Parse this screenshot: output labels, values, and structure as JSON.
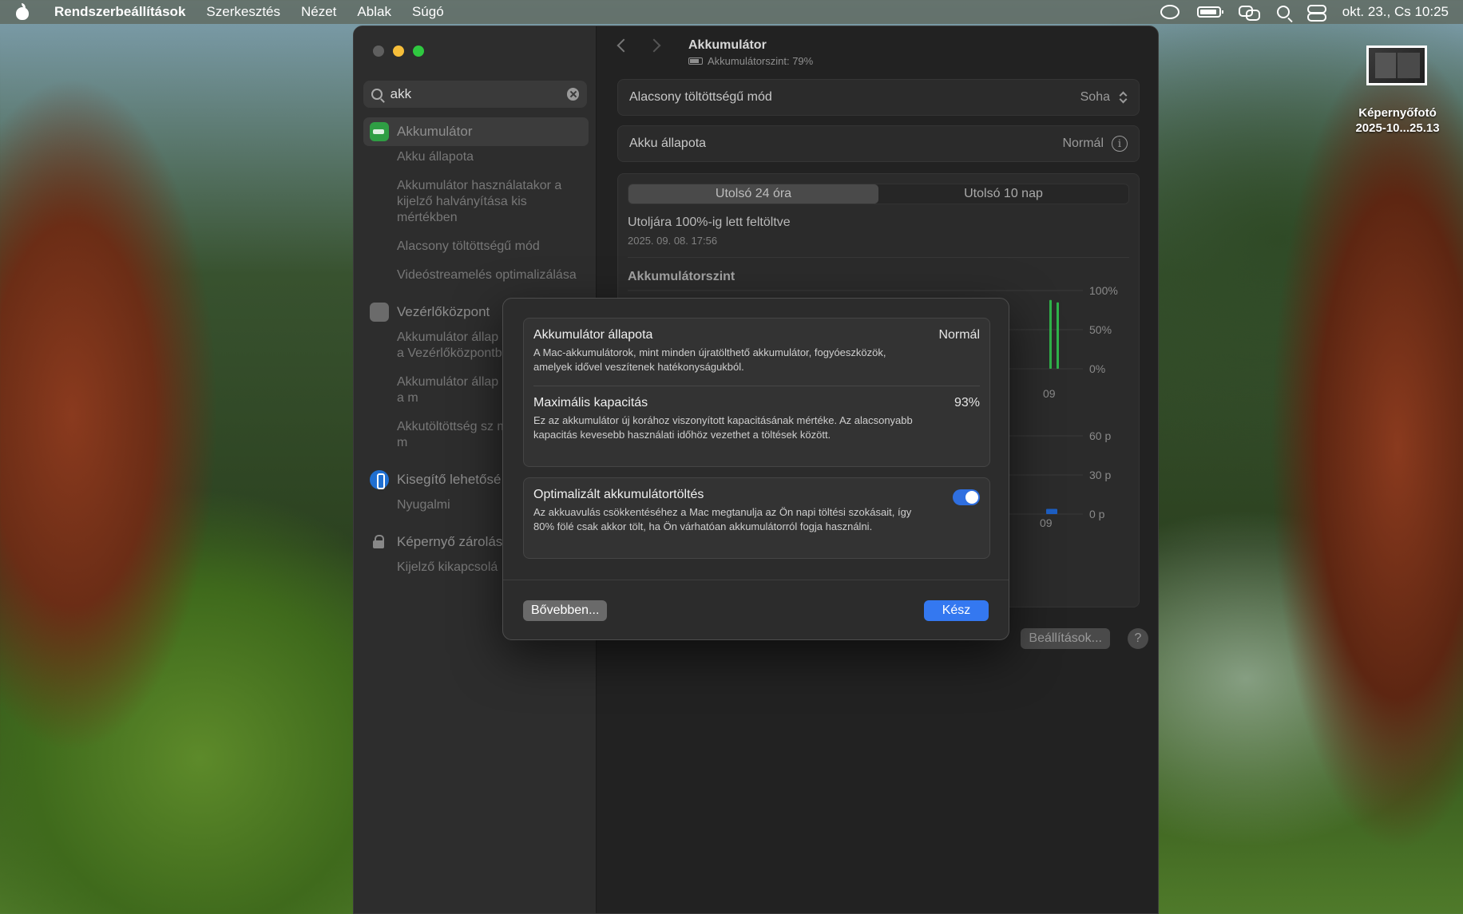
{
  "menubar": {
    "app": "Rendszerbeállítások",
    "items": [
      "Szerkesztés",
      "Nézet",
      "Ablak",
      "Súgó"
    ],
    "clock": "okt. 23., Cs  10:25"
  },
  "desktop": {
    "file_label_line1": "Képernyőfotó",
    "file_label_line2": "2025-10...25.13"
  },
  "sidebar": {
    "search_value": "akk",
    "groups": [
      {
        "title": "Akkumulátor",
        "subs": [
          "Akku állapota",
          "Akkumulátor használatakor a kijelző halványítása kis mértékben",
          "Alacsony töltöttségű mód",
          "Videóstreamelés optimalizálása"
        ]
      },
      {
        "title": "Vezérlőközpont",
        "subs": [
          "Akkumulátor állap megjelenítése a Vezérlőközpontba",
          "Akkumulátor állap megjelenítése a m",
          "Akkutöltöttség sz megjelenítése a m"
        ]
      },
      {
        "title": "Kisegítő lehetősé",
        "subs": [
          "Nyugalmi"
        ]
      },
      {
        "title": "Képernyő zárolás",
        "subs": [
          "Kijelző kikapcsolá"
        ]
      }
    ]
  },
  "main": {
    "title": "Akkumulátor",
    "subtitle": "Akkumulátorszint: 79%",
    "low_power": {
      "label": "Alacsony töltöttségű mód",
      "value": "Soha"
    },
    "health": {
      "label": "Akku állapota",
      "value": "Normál"
    },
    "tabs": [
      "Utolsó 24 óra",
      "Utolsó 10 nap"
    ],
    "last_charged": "Utoljára 100%-ig lett feltöltve",
    "last_charged_date": "2025. 09. 08. 17:56",
    "level_title": "Akkumulátorszint",
    "settings_button": "Beállítások...",
    "help_button": "?"
  },
  "chart_data": [
    {
      "type": "bar",
      "title": "Akkumulátorszint",
      "yticks": [
        "100%",
        "50%",
        "0%"
      ],
      "ylim": [
        0,
        100
      ],
      "x_tick": "09",
      "bars": [
        {
          "x": "09",
          "value": 88,
          "color": "#2fb34a"
        },
        {
          "x": "09",
          "value": 85,
          "color": "#2fb34a"
        }
      ]
    },
    {
      "type": "bar",
      "yticks": [
        "60 p",
        "30 p",
        "0 p"
      ],
      "ylim": [
        0,
        60
      ],
      "x_tick": "09",
      "bars": [
        {
          "x": "09",
          "value": 4,
          "color": "#1d5fc4"
        }
      ]
    }
  ],
  "sheet": {
    "health_title": "Akkumulátor állapota",
    "health_value": "Normál",
    "health_desc": "A Mac-akkumulátorok, mint minden újratölthető akkumulátor, fogyóeszközök, amelyek idővel veszítenek hatékonyságukból.",
    "capacity_title": "Maximális kapacitás",
    "capacity_value": "93%",
    "capacity_desc": "Ez az akkumulátor új korához viszonyított kapacitásának mértéke. Az alacsonyabb kapacitás kevesebb használati időhöz vezethet a töltések között.",
    "optimized_title": "Optimalizált akkumulátortöltés",
    "optimized_desc": "Az akkuavulás csökkentéséhez a Mac megtanulja az Ön napi töltési szokásait, így 80% fölé csak akkor tölt, ha Ön várhatóan akkumulátorról fogja használni.",
    "more_button": "Bővebben...",
    "done_button": "Kész"
  }
}
